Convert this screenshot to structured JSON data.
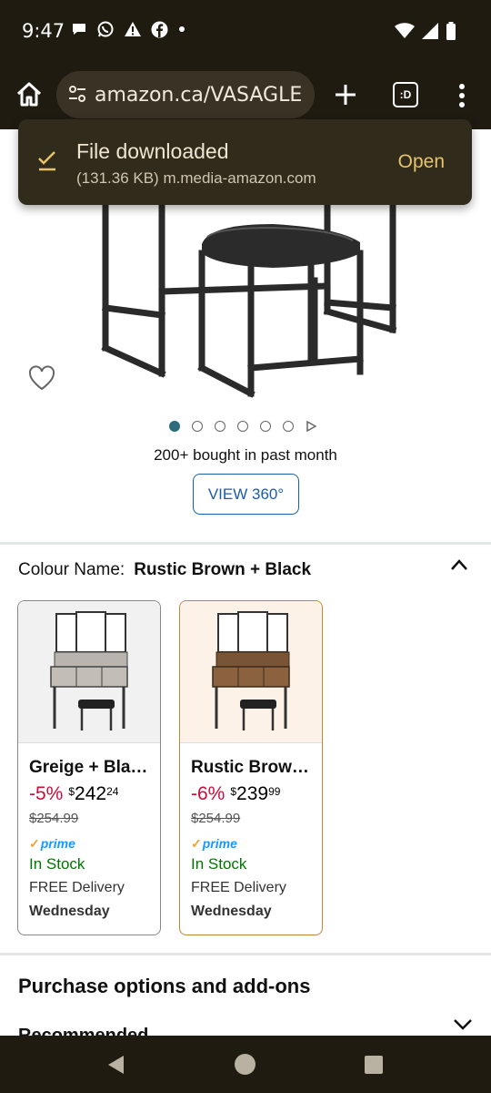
{
  "status_bar": {
    "time": "9:47",
    "left_icons": [
      "chat-bubble-icon",
      "whatsapp-icon",
      "warning-icon",
      "facebook-icon",
      "dot-icon"
    ],
    "right_icons": [
      "wifi-icon",
      "signal-icon",
      "battery-icon"
    ]
  },
  "browser": {
    "url": "amazon.ca/VASAGLE",
    "tab_switcher_label": ":D"
  },
  "toast": {
    "title": "File downloaded",
    "subtitle": "(131.36 KB) m.media-amazon.com",
    "action": "Open"
  },
  "gallery": {
    "image_count": 6,
    "active_index": 0,
    "has_video": true
  },
  "product": {
    "bought_text": "200+ bought in past month",
    "view360_label": "VIEW 360°",
    "colour_label": "Colour Name:",
    "colour_value": "Rustic Brown + Black"
  },
  "variants": [
    {
      "name": "Greige + Bla…",
      "discount": "-5%",
      "currency": "$",
      "price_whole": "242",
      "price_fraction": "24",
      "was_price": "$254.99",
      "prime_check": "✓",
      "prime_label": "prime",
      "stock": "In Stock",
      "delivery": "FREE Delivery",
      "delivery_day": "Wednesday",
      "selected": false
    },
    {
      "name": "Rustic Brow…",
      "discount": "-6%",
      "currency": "$",
      "price_whole": "239",
      "price_fraction": "99",
      "was_price": "$254.99",
      "prime_check": "✓",
      "prime_label": "prime",
      "stock": "In Stock",
      "delivery": "FREE Delivery",
      "delivery_day": "Wednesday",
      "selected": true
    }
  ],
  "sections": {
    "purchase_options": "Purchase options and add-ons",
    "partial_heading": "Recommended"
  },
  "colors": {
    "system_bar": "#201b11",
    "accent_link": "#1c5da8",
    "discount": "#cc0c39",
    "in_stock": "#007600",
    "selected_border": "#c58433"
  }
}
